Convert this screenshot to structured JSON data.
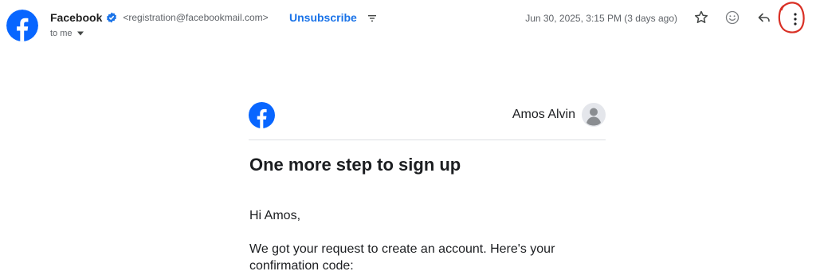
{
  "header": {
    "sender_name": "Facebook",
    "sender_email": "<registration@facebookmail.com>",
    "unsubscribe_label": "Unsubscribe",
    "recipient_label": "to me",
    "timestamp": "Jun 30, 2025, 3:15 PM (3 days ago)",
    "icons": [
      "facebook-logo-icon",
      "verified-icon",
      "filter-icon",
      "chevron-down-icon",
      "star-icon",
      "emoji-icon",
      "reply-icon",
      "more-vert-icon"
    ],
    "annotation_color": "#d93025"
  },
  "email": {
    "account_name": "Amos Alvin",
    "heading": "One more step to sign up",
    "greeting": "Hi Amos,",
    "paragraph": "We got your request to create an account. Here's your confirmation code:"
  },
  "colors": {
    "facebook_blue": "#0866ff",
    "link_blue": "#1a73e8",
    "verified_blue": "#1a73e8"
  }
}
